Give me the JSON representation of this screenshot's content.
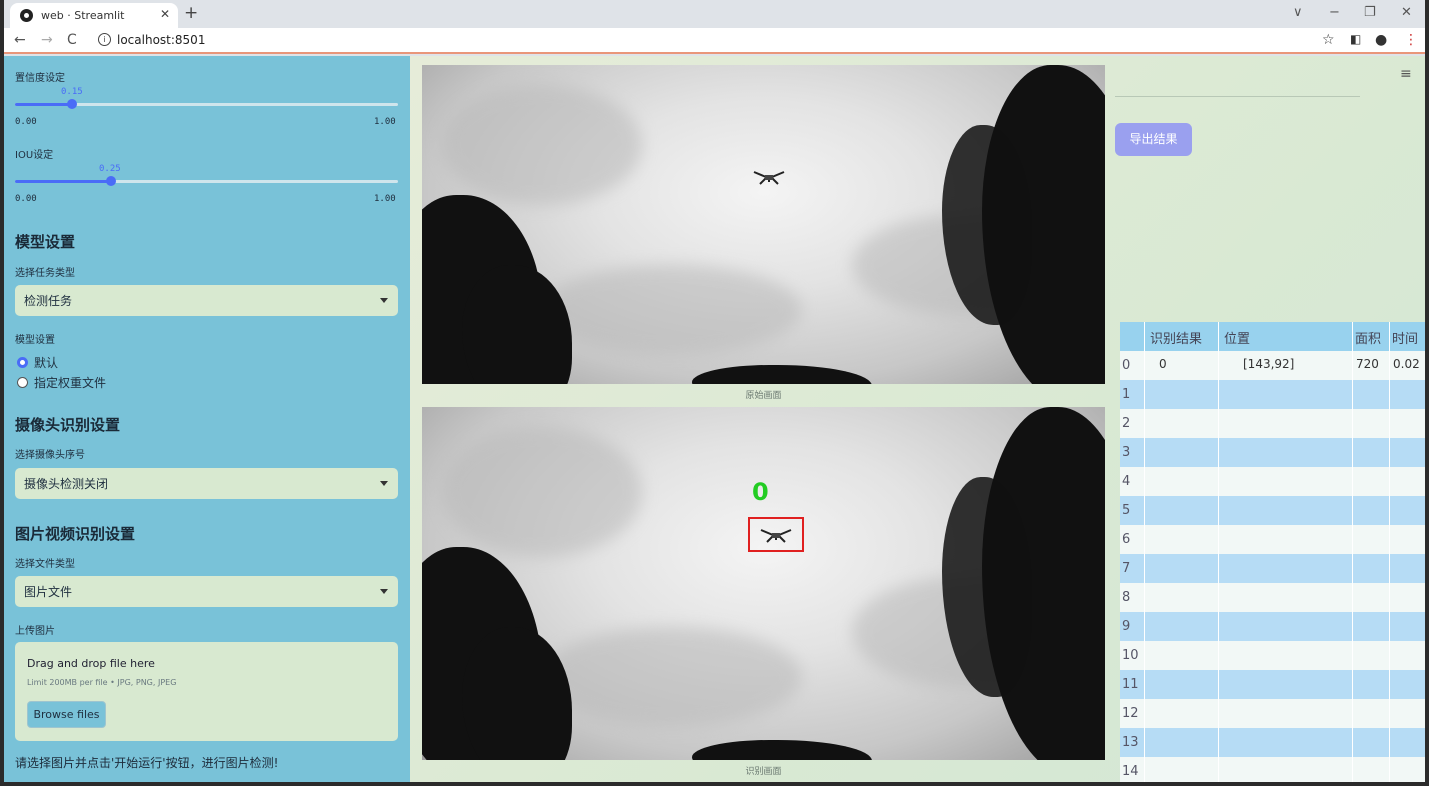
{
  "browser": {
    "tab_title": "web · Streamlit",
    "tab_close": "✕",
    "new_tab": "+",
    "url": "localhost:8501",
    "back": "←",
    "forward": "→",
    "reload": "C",
    "star": "☆",
    "minimize": "∨",
    "min2": "−",
    "restore": "❐",
    "close": "✕"
  },
  "sidebar": {
    "confidence_label": "置信度设定",
    "confidence_value": "0.15",
    "confidence_level": 0.15,
    "iou_label": "IOU设定",
    "iou_value": "0.25",
    "iou_level": 0.25,
    "slider_min": "0.00",
    "slider_max": "1.00",
    "model_header": "模型设置",
    "task_label": "选择任务类型",
    "task_value": "检测任务",
    "model_label": "模型设置",
    "radio_default": "默认",
    "radio_custom": "指定权重文件",
    "camera_header": "摄像头识别设置",
    "camera_label": "选择摄像头序号",
    "camera_value": "摄像头检测关闭",
    "media_header": "图片视频识别设置",
    "filetype_label": "选择文件类型",
    "filetype_value": "图片文件",
    "upload_label": "上传图片",
    "upload_drag": "Drag and drop file here",
    "upload_limit": "Limit 200MB per file • JPG, PNG, JPEG",
    "browse_button": "Browse files",
    "hint": "请选择图片并点击'开始运行'按钮，进行图片检测!"
  },
  "main": {
    "caption_original": "原始画面",
    "caption_detect": "识别画面",
    "detect_label": "0",
    "export_button": "导出结果",
    "menu_icon": "≡"
  },
  "table": {
    "columns": [
      "识别结果",
      "位置",
      "面积",
      "时间"
    ],
    "rows": [
      {
        "index": "0",
        "result": "0",
        "position": "[143,92]",
        "area": "720",
        "time": "0.02"
      },
      {
        "index": "1",
        "result": "",
        "position": "",
        "area": "",
        "time": ""
      },
      {
        "index": "2",
        "result": "",
        "position": "",
        "area": "",
        "time": ""
      },
      {
        "index": "3",
        "result": "",
        "position": "",
        "area": "",
        "time": ""
      },
      {
        "index": "4",
        "result": "",
        "position": "",
        "area": "",
        "time": ""
      },
      {
        "index": "5",
        "result": "",
        "position": "",
        "area": "",
        "time": ""
      },
      {
        "index": "6",
        "result": "",
        "position": "",
        "area": "",
        "time": ""
      },
      {
        "index": "7",
        "result": "",
        "position": "",
        "area": "",
        "time": ""
      },
      {
        "index": "8",
        "result": "",
        "position": "",
        "area": "",
        "time": ""
      },
      {
        "index": "9",
        "result": "",
        "position": "",
        "area": "",
        "time": ""
      },
      {
        "index": "10",
        "result": "",
        "position": "",
        "area": "",
        "time": ""
      },
      {
        "index": "11",
        "result": "",
        "position": "",
        "area": "",
        "time": ""
      },
      {
        "index": "12",
        "result": "",
        "position": "",
        "area": "",
        "time": ""
      },
      {
        "index": "13",
        "result": "",
        "position": "",
        "area": "",
        "time": ""
      },
      {
        "index": "14",
        "result": "",
        "position": "",
        "area": "",
        "time": ""
      }
    ]
  },
  "colors": {
    "sidebar_bg": "#79c2d8",
    "accent": "#4a6cf7",
    "export_bg": "#9aa0ef",
    "table_header": "#98d2ee",
    "detect_box": "#e02020",
    "detect_label": "#22cc22"
  }
}
